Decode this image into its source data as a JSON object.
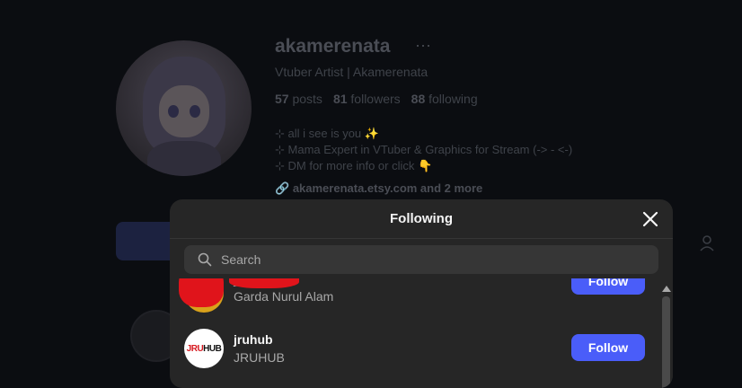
{
  "profile": {
    "username": "akamerenata",
    "more_icon": "more-horizontal-icon",
    "subtitle": "Vtuber Artist | Akamerenata",
    "stats": {
      "posts_count": "57",
      "posts_label": "posts",
      "followers_count": "81",
      "followers_label": "followers",
      "following_count": "88",
      "following_label": "following"
    },
    "bio_lines": [
      "⊹ all i see is you ✨",
      "⊹ Mama Expert in VTuber & Graphics for Stream (-> - <-)",
      "⊹ DM for more info or click 👇"
    ],
    "link_text": "akamerenata.etsy.com and 2 more"
  },
  "modal": {
    "title": "Following",
    "search_placeholder": "Search",
    "accounts": [
      {
        "username": "_",
        "full_name": "Garda Nurul Alam",
        "follow_label": "Follow",
        "redacted": true
      },
      {
        "username": "jruhub",
        "full_name": "JRUHUB",
        "follow_label": "Follow",
        "logo_text_red": "JRU",
        "logo_text_dark": "HUB"
      }
    ]
  },
  "colors": {
    "accent": "#4a5df9",
    "modal_bg": "#262626",
    "page_bg": "#0b0d11",
    "redaction": "#e0141b"
  }
}
